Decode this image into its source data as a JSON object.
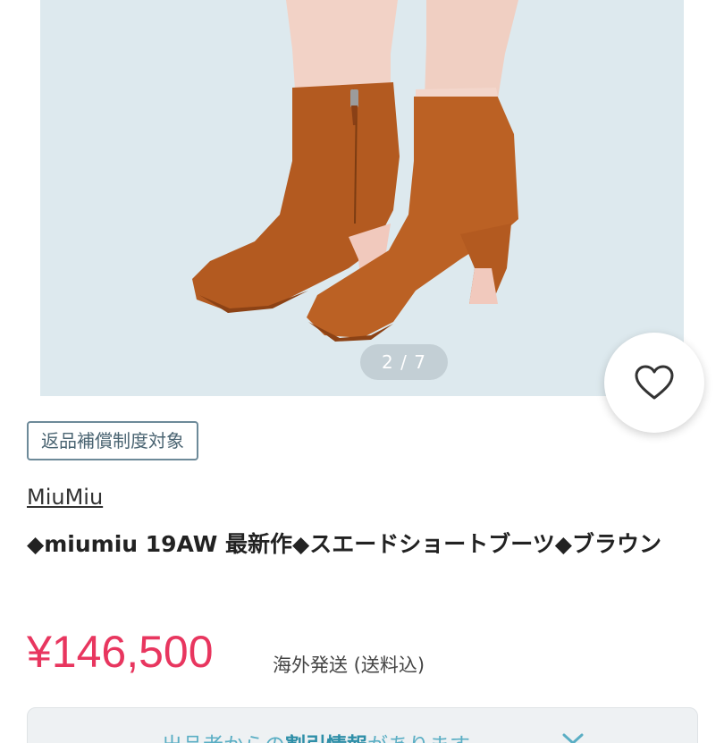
{
  "gallery": {
    "counter": "2 / 7",
    "background_color": "#dde9ee",
    "image_alt": "suede ankle boots"
  },
  "favorite": {
    "icon": "heart-outline-icon"
  },
  "badge": {
    "label": "返品補償制度対象"
  },
  "product": {
    "brand": "MiuMiu",
    "title": "◆miumiu 19AW 最新作◆スエードショートブーツ◆ブラウン",
    "price": "¥146,500",
    "shipping": "海外発送 (送料込)",
    "price_color": "#e8365f"
  },
  "notice": {
    "text_pre": "出品者からの",
    "text_bold": "割引情報",
    "text_post": "があります",
    "icon": "chevron-down-icon"
  }
}
